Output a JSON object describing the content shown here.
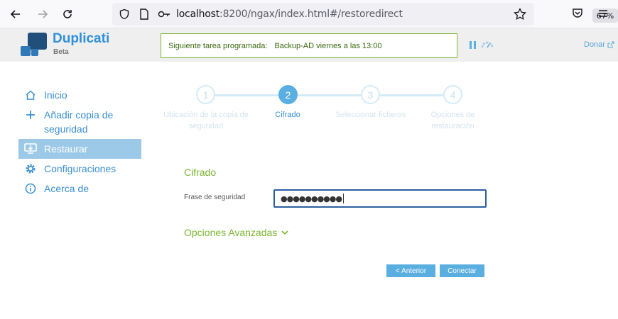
{
  "browser": {
    "url_host": "localhost",
    "url_path": ":8200/ngax/index.html#/restoredirect",
    "zoom": "67%"
  },
  "header": {
    "brand": "Duplicati",
    "brand_sub": "Beta",
    "schedule_label": "Siguiente tarea programada:",
    "schedule_value": "Backup-AD viernes a las 13:00",
    "donate": "Donar"
  },
  "sidebar": {
    "items": [
      {
        "label": "Inicio",
        "icon": "home-icon"
      },
      {
        "label": "Añadir copia de seguridad",
        "icon": "plus-icon"
      },
      {
        "label": "Restaurar",
        "icon": "restore-icon",
        "active": true
      },
      {
        "label": "Configuraciones",
        "icon": "gear-icon"
      },
      {
        "label": "Acerca de",
        "icon": "info-icon"
      }
    ]
  },
  "stepper": {
    "steps": [
      {
        "number": "1",
        "label": "Ubicación de la copia de seguridad"
      },
      {
        "number": "2",
        "label": "Cifrado",
        "active": true
      },
      {
        "number": "3",
        "label": "Seleccionar ficheros"
      },
      {
        "number": "4",
        "label": "Opciones de restauración"
      }
    ]
  },
  "form": {
    "section_title": "Cifrado",
    "passphrase_label": "Frase de seguridad",
    "passphrase_value": "●●●●●●●●●●",
    "advanced_label": "Opciones Avanzadas"
  },
  "buttons": {
    "previous": "< Anterior",
    "next": "Conectar"
  },
  "colors": {
    "accent_blue": "#5aaee0",
    "accent_green": "#7ab530",
    "active_sidebar": "#9cc9e8"
  }
}
